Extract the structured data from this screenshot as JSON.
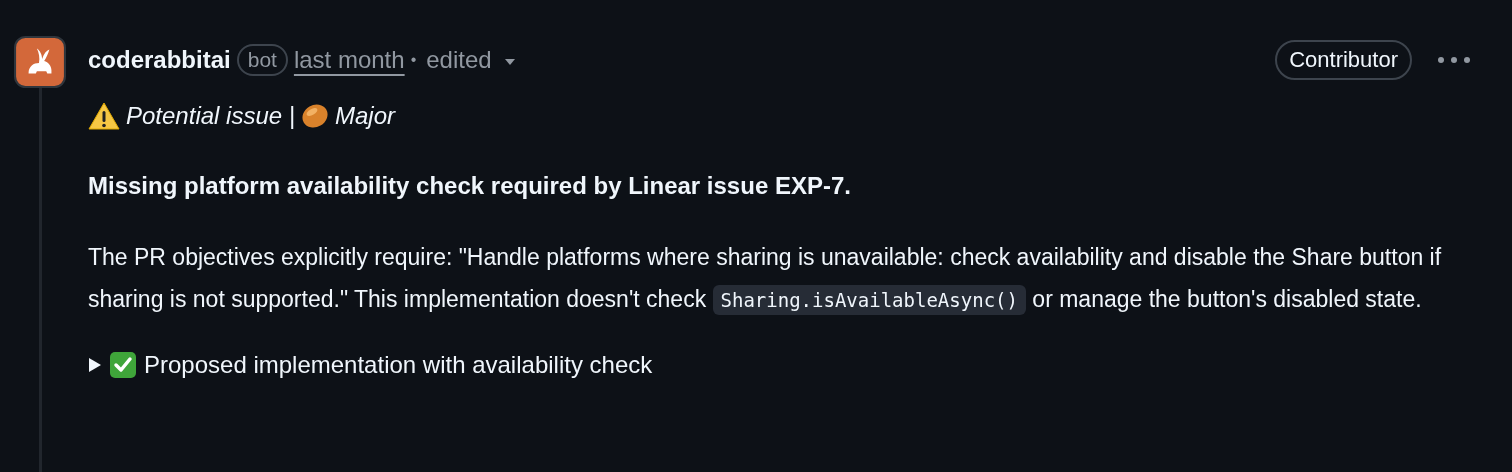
{
  "comment": {
    "author": "coderabbitai",
    "author_badge": "bot",
    "time": "last month",
    "separator": "•",
    "edited": "edited",
    "role_badge": "Contributor",
    "severity": {
      "type": "Potential issue",
      "separator": "|",
      "level": "Major"
    },
    "heading": "Missing platform availability check required by Linear issue EXP-7.",
    "paragraph": [
      {
        "kind": "text",
        "text": "The PR objectives explicitly require: \"Handle platforms where sharing is unavailable: check availability and disable the Share button if sharing is not supported.\" This implementation doesn't check"
      },
      {
        "kind": "code",
        "text": "Sharing.isAvailableAsync()"
      },
      {
        "kind": "text",
        "text": "or manage the button's disabled state."
      }
    ],
    "details": {
      "summary": "Proposed implementation with availability check",
      "expanded": false
    }
  }
}
